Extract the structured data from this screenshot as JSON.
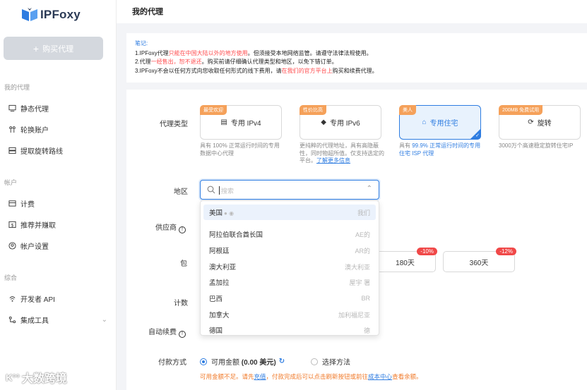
{
  "brand": {
    "name": "IPFoxy",
    "accent": "#2f7de1"
  },
  "sidebar": {
    "buy_button": "购买代理",
    "section_proxy": "我的代理",
    "proxy_items": [
      {
        "label": "静态代理",
        "icon": "monitor-icon"
      },
      {
        "label": "轮换账户",
        "icon": "users-icon"
      },
      {
        "label": "提取旋转路线",
        "icon": "server-icon"
      }
    ],
    "section_account": "帐户",
    "account_items": [
      {
        "label": "计费",
        "icon": "billing-icon"
      },
      {
        "label": "推荐并赚取",
        "icon": "dollar-icon"
      },
      {
        "label": "帐户设置",
        "icon": "user-settings-icon"
      }
    ],
    "section_general": "综合",
    "general_items": [
      {
        "label": "开发者 API",
        "icon": "api-icon"
      },
      {
        "label": "集成工具",
        "icon": "integration-icon"
      }
    ]
  },
  "header": {
    "title": "我的代理"
  },
  "notice": {
    "title": "笔记:",
    "line1_a": "1.IPFoxy代理",
    "line1_red": "只能在中国大陆以外的地方使用",
    "line1_b": "。但须接受本地网络监管。请遵守法律法规使用。",
    "line2_a": "2.代理",
    "line2_red": "一经售出，恕不退还",
    "line2_b": "。购买前请仔细确认代理类型和地区，以免下错订单。",
    "line3_a": "3.IPFoxy不会以任何方式向您收取任何形式的线下费用，请",
    "line3_red": "在我们的官方平台上",
    "line3_b": "购买和续费代理。"
  },
  "form": {
    "proxy_type_label": "代理类型",
    "region_label": "地区",
    "supplier_label": "供应商",
    "package_label": "包",
    "count_label": "计数",
    "auto_renew_label": "自动续费",
    "payment_label": "付款方式"
  },
  "proxy_types": [
    {
      "tag": "最受欢迎",
      "name": "专用 IPv4",
      "icon": "server-icon",
      "desc": "具有 100% 正常运行时间的专用数据中心代理",
      "active": false
    },
    {
      "tag": "性价比高",
      "name": "专用 IPv6",
      "icon": "graduation-icon",
      "desc": "更纯粹的代理地址，具有高隐蔽性，同时物超所值。仅支持选定的平台。",
      "link": "了解更多信息",
      "active": false
    },
    {
      "tag": "美人",
      "name": "专用住宅",
      "icon": "home-icon",
      "desc_a": "具有 ",
      "desc_b": "99.9% 正常运行时间的专用住宅 ISP 代理",
      "active": true
    },
    {
      "tag": "200MB 免费试用",
      "name": "旋转",
      "icon": "rotate-icon",
      "desc": "3000万个高速稳定旋转住宅IP",
      "active": false
    }
  ],
  "region": {
    "placeholder": "搜索",
    "options": [
      {
        "name": "美国",
        "code": "我们",
        "selected": true
      },
      {
        "name": "阿拉伯联合酋长国",
        "code": "AE的"
      },
      {
        "name": "阿根廷",
        "code": "AR的"
      },
      {
        "name": "澳大利亚",
        "code": "澳大利亚"
      },
      {
        "name": "孟加拉",
        "code": "屋宇 署"
      },
      {
        "name": "巴西",
        "code": "BR"
      },
      {
        "name": "加拿大",
        "code": "加利福尼亚"
      },
      {
        "name": "德国",
        "code": "德"
      }
    ]
  },
  "periods": [
    {
      "label": "180天",
      "discount": "-10%"
    },
    {
      "label": "360天",
      "discount": "-12%"
    }
  ],
  "payment": {
    "balance_label": "可用金额",
    "balance_value": "(0.00 美元)",
    "other_method": "选择方法",
    "warn_a": "可用金额不足。请先",
    "warn_link1": "充值",
    "warn_b": "，付款完成后可以点击刷新按钮或前往",
    "warn_link2": "成本中心",
    "warn_c": "查看余额。"
  },
  "watermark": "大数跨境"
}
